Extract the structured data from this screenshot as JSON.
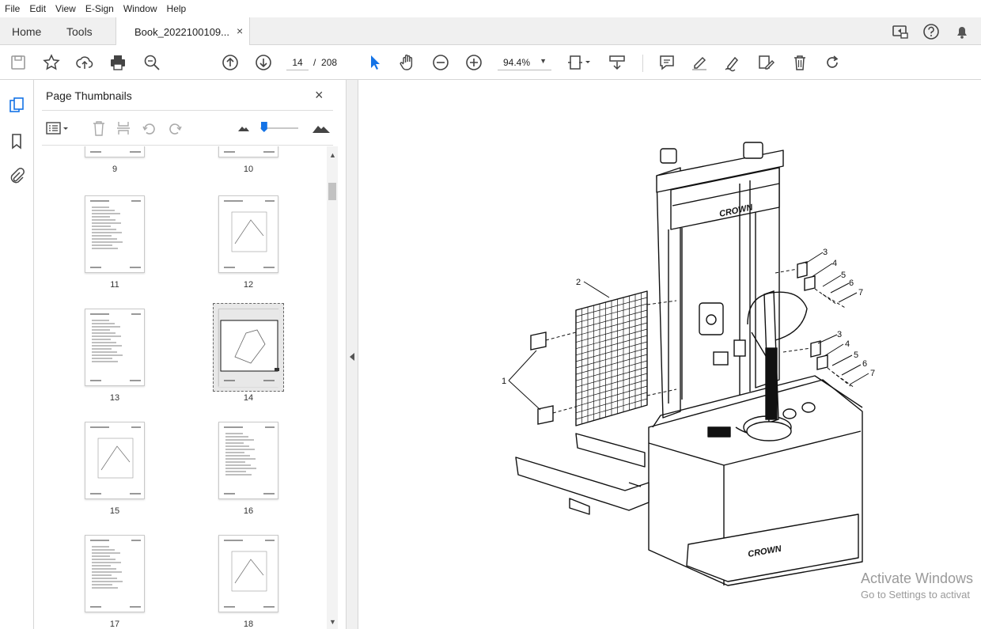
{
  "menu": [
    "File",
    "Edit",
    "View",
    "E-Sign",
    "Window",
    "Help"
  ],
  "tabs": {
    "home": "Home",
    "tools": "Tools",
    "document": "Book_2022100109...",
    "close_glyph": "×"
  },
  "toolbar": {
    "page_current": "14",
    "page_separator": "/",
    "page_total": "208",
    "zoom": "94.4%"
  },
  "panel": {
    "title": "Page Thumbnails",
    "close_glyph": "×",
    "slider_value": 0.1,
    "thumbnails": [
      {
        "page": "9",
        "selected": false
      },
      {
        "page": "10",
        "selected": false
      },
      {
        "page": "11",
        "selected": false
      },
      {
        "page": "12",
        "selected": false
      },
      {
        "page": "13",
        "selected": false
      },
      {
        "page": "14",
        "selected": true
      },
      {
        "page": "15",
        "selected": false
      },
      {
        "page": "16",
        "selected": false
      },
      {
        "page": "17",
        "selected": false
      },
      {
        "page": "18",
        "selected": false
      }
    ]
  },
  "drawing": {
    "callouts": [
      "1",
      "2",
      "3",
      "4",
      "5",
      "6",
      "7",
      "3",
      "4",
      "5",
      "6",
      "7"
    ],
    "brand": "CROWN"
  },
  "watermark": {
    "line1": "Activate Windows",
    "line2": "Go to Settings to activat"
  },
  "colors": {
    "accent": "#1473e6",
    "toolbar_icon": "#444444"
  }
}
